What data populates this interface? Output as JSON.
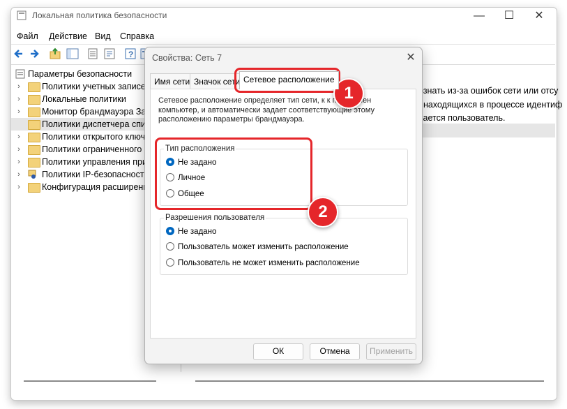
{
  "window": {
    "title": "Локальная политика безопасности",
    "minimize": "—",
    "maximize": "☐",
    "close": "✕"
  },
  "menu": [
    "Файл",
    "Действие",
    "Вид",
    "Справка"
  ],
  "toolbar_icons": [
    "back-arrow-icon",
    "forward-arrow-icon",
    "up-folder-icon",
    "show-hide-tree-icon",
    "export-list-icon",
    "properties-icon",
    "help-icon",
    "console-icon"
  ],
  "tree": {
    "root": "Параметры безопасности",
    "items": [
      "Политики учетных записей",
      "Локальные политики",
      "Монитор брандмауэра Защ",
      "Политики диспетчера спис",
      "Политики открытого ключа",
      "Политики ограниченного и",
      "Политики управления при",
      "Политики IP-безопасности",
      "Конфигурация расширенно"
    ]
  },
  "right_pane": {
    "lines": [
      "ознать из-за ошибок сети или отсу",
      ", находящихся в процессе идентиф",
      "чается пользователь."
    ]
  },
  "dialog": {
    "title": "Свойства: Сеть 7",
    "close": "✕",
    "tabs": [
      "Имя сети",
      "Значок сети",
      "Сетевое расположение"
    ],
    "description": "Сетевое расположение определяет тип сети, к к                подключен компьютер, и автоматически задает соответствующие этому расположению параметры брандмауэра.",
    "location_group": {
      "legend": "Тип расположения",
      "options": [
        "Не задано",
        "Личное",
        "Общее"
      ],
      "selected": 0
    },
    "permissions_group": {
      "legend": "Разрешения пользователя",
      "options": [
        "Не задано",
        "Пользователь может изменить расположение",
        "Пользователь не может изменить расположение"
      ],
      "selected": 0
    },
    "buttons": {
      "ok": "ОК",
      "cancel": "Отмена",
      "apply": "Применить"
    }
  },
  "annotations": {
    "badge1": "1",
    "badge2": "2",
    "color": "#e5262a"
  }
}
